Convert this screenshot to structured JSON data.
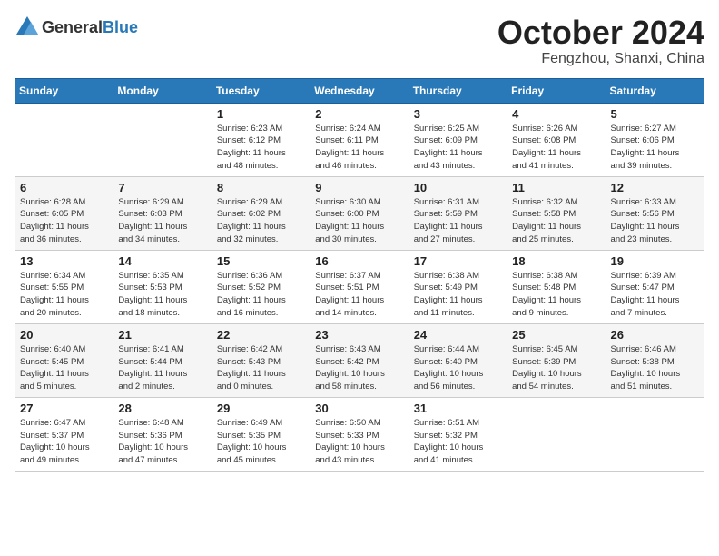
{
  "header": {
    "logo_general": "General",
    "logo_blue": "Blue",
    "month_title": "October 2024",
    "location": "Fengzhou, Shanxi, China"
  },
  "days_of_week": [
    "Sunday",
    "Monday",
    "Tuesday",
    "Wednesday",
    "Thursday",
    "Friday",
    "Saturday"
  ],
  "weeks": [
    [
      {
        "day": null,
        "info": null
      },
      {
        "day": null,
        "info": null
      },
      {
        "day": "1",
        "info": "Sunrise: 6:23 AM\nSunset: 6:12 PM\nDaylight: 11 hours\nand 48 minutes."
      },
      {
        "day": "2",
        "info": "Sunrise: 6:24 AM\nSunset: 6:11 PM\nDaylight: 11 hours\nand 46 minutes."
      },
      {
        "day": "3",
        "info": "Sunrise: 6:25 AM\nSunset: 6:09 PM\nDaylight: 11 hours\nand 43 minutes."
      },
      {
        "day": "4",
        "info": "Sunrise: 6:26 AM\nSunset: 6:08 PM\nDaylight: 11 hours\nand 41 minutes."
      },
      {
        "day": "5",
        "info": "Sunrise: 6:27 AM\nSunset: 6:06 PM\nDaylight: 11 hours\nand 39 minutes."
      }
    ],
    [
      {
        "day": "6",
        "info": "Sunrise: 6:28 AM\nSunset: 6:05 PM\nDaylight: 11 hours\nand 36 minutes."
      },
      {
        "day": "7",
        "info": "Sunrise: 6:29 AM\nSunset: 6:03 PM\nDaylight: 11 hours\nand 34 minutes."
      },
      {
        "day": "8",
        "info": "Sunrise: 6:29 AM\nSunset: 6:02 PM\nDaylight: 11 hours\nand 32 minutes."
      },
      {
        "day": "9",
        "info": "Sunrise: 6:30 AM\nSunset: 6:00 PM\nDaylight: 11 hours\nand 30 minutes."
      },
      {
        "day": "10",
        "info": "Sunrise: 6:31 AM\nSunset: 5:59 PM\nDaylight: 11 hours\nand 27 minutes."
      },
      {
        "day": "11",
        "info": "Sunrise: 6:32 AM\nSunset: 5:58 PM\nDaylight: 11 hours\nand 25 minutes."
      },
      {
        "day": "12",
        "info": "Sunrise: 6:33 AM\nSunset: 5:56 PM\nDaylight: 11 hours\nand 23 minutes."
      }
    ],
    [
      {
        "day": "13",
        "info": "Sunrise: 6:34 AM\nSunset: 5:55 PM\nDaylight: 11 hours\nand 20 minutes."
      },
      {
        "day": "14",
        "info": "Sunrise: 6:35 AM\nSunset: 5:53 PM\nDaylight: 11 hours\nand 18 minutes."
      },
      {
        "day": "15",
        "info": "Sunrise: 6:36 AM\nSunset: 5:52 PM\nDaylight: 11 hours\nand 16 minutes."
      },
      {
        "day": "16",
        "info": "Sunrise: 6:37 AM\nSunset: 5:51 PM\nDaylight: 11 hours\nand 14 minutes."
      },
      {
        "day": "17",
        "info": "Sunrise: 6:38 AM\nSunset: 5:49 PM\nDaylight: 11 hours\nand 11 minutes."
      },
      {
        "day": "18",
        "info": "Sunrise: 6:38 AM\nSunset: 5:48 PM\nDaylight: 11 hours\nand 9 minutes."
      },
      {
        "day": "19",
        "info": "Sunrise: 6:39 AM\nSunset: 5:47 PM\nDaylight: 11 hours\nand 7 minutes."
      }
    ],
    [
      {
        "day": "20",
        "info": "Sunrise: 6:40 AM\nSunset: 5:45 PM\nDaylight: 11 hours\nand 5 minutes."
      },
      {
        "day": "21",
        "info": "Sunrise: 6:41 AM\nSunset: 5:44 PM\nDaylight: 11 hours\nand 2 minutes."
      },
      {
        "day": "22",
        "info": "Sunrise: 6:42 AM\nSunset: 5:43 PM\nDaylight: 11 hours\nand 0 minutes."
      },
      {
        "day": "23",
        "info": "Sunrise: 6:43 AM\nSunset: 5:42 PM\nDaylight: 10 hours\nand 58 minutes."
      },
      {
        "day": "24",
        "info": "Sunrise: 6:44 AM\nSunset: 5:40 PM\nDaylight: 10 hours\nand 56 minutes."
      },
      {
        "day": "25",
        "info": "Sunrise: 6:45 AM\nSunset: 5:39 PM\nDaylight: 10 hours\nand 54 minutes."
      },
      {
        "day": "26",
        "info": "Sunrise: 6:46 AM\nSunset: 5:38 PM\nDaylight: 10 hours\nand 51 minutes."
      }
    ],
    [
      {
        "day": "27",
        "info": "Sunrise: 6:47 AM\nSunset: 5:37 PM\nDaylight: 10 hours\nand 49 minutes."
      },
      {
        "day": "28",
        "info": "Sunrise: 6:48 AM\nSunset: 5:36 PM\nDaylight: 10 hours\nand 47 minutes."
      },
      {
        "day": "29",
        "info": "Sunrise: 6:49 AM\nSunset: 5:35 PM\nDaylight: 10 hours\nand 45 minutes."
      },
      {
        "day": "30",
        "info": "Sunrise: 6:50 AM\nSunset: 5:33 PM\nDaylight: 10 hours\nand 43 minutes."
      },
      {
        "day": "31",
        "info": "Sunrise: 6:51 AM\nSunset: 5:32 PM\nDaylight: 10 hours\nand 41 minutes."
      },
      {
        "day": null,
        "info": null
      },
      {
        "day": null,
        "info": null
      }
    ]
  ]
}
